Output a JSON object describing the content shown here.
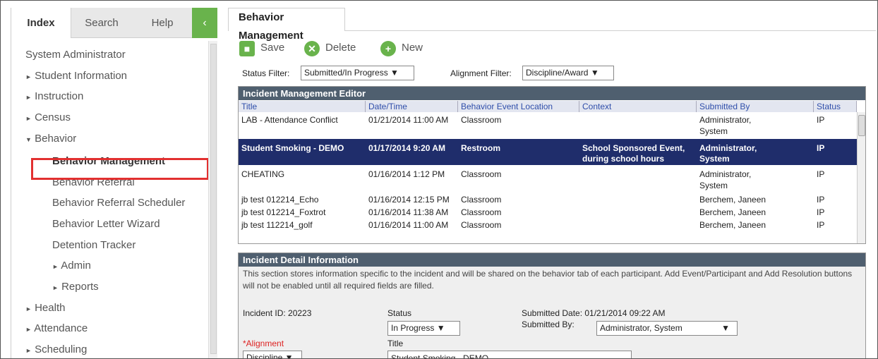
{
  "left_panel": {
    "tabs": [
      "Index",
      "Search",
      "Help"
    ],
    "collapse_symbol": "‹",
    "tree": [
      {
        "label": "System Administrator"
      },
      {
        "label": "Student Information",
        "arrow": "►"
      },
      {
        "label": "Instruction",
        "arrow": "►"
      },
      {
        "label": "Census",
        "arrow": "►"
      },
      {
        "label": "Behavior",
        "arrow": "▼"
      },
      {
        "label": "Behavior Management"
      },
      {
        "label": "Behavior Referral"
      },
      {
        "label": "Behavior Referral Scheduler"
      },
      {
        "label": "Behavior Letter Wizard"
      },
      {
        "label": "Detention Tracker"
      },
      {
        "label": "Admin",
        "arrow": "►"
      },
      {
        "label": "Reports",
        "arrow": "►"
      },
      {
        "label": "Health",
        "arrow": "►"
      },
      {
        "label": "Attendance",
        "arrow": "►"
      },
      {
        "label": "Scheduling",
        "arrow": "►"
      }
    ]
  },
  "main": {
    "tab_title": "Behavior Management",
    "toolbar": {
      "save_label": "Save",
      "delete_label": "Delete",
      "new_label": "New",
      "save_icon": "■",
      "delete_icon": "✕",
      "new_icon": "+"
    },
    "filters": {
      "status_label": "Status Filter:",
      "status_value": "Submitted/In Progress ▼",
      "alignment_label": "Alignment Filter:",
      "alignment_value": "Discipline/Award ▼"
    },
    "editor": {
      "title": "Incident Management Editor",
      "columns": [
        "Title",
        "Date/Time",
        "Behavior Event Location",
        "Context",
        "Submitted By",
        "Status"
      ],
      "rows": [
        {
          "title": "LAB - Attendance Conflict",
          "date": "01/21/2014 11:00 AM",
          "location": "Classroom",
          "context": "",
          "submitted_by_1": "Administrator,",
          "submitted_by_2": "System",
          "status": "IP"
        },
        {
          "title": "Student Smoking - DEMO",
          "date": "01/17/2014 9:20 AM",
          "location": "Restroom",
          "context_1": "School Sponsored Event,",
          "context_2": "during school hours",
          "submitted_by_1": "Administrator,",
          "submitted_by_2": "System",
          "status": "IP"
        },
        {
          "title": "CHEATING",
          "date": "01/16/2014 1:12 PM",
          "location": "Classroom",
          "context": "",
          "submitted_by_1": "Administrator,",
          "submitted_by_2": "System",
          "status": "IP"
        },
        {
          "title": "jb test 012214_Echo",
          "date": "01/16/2014 12:15 PM",
          "location": "Classroom",
          "submitted_by": "Berchem, Janeen",
          "status": "IP"
        },
        {
          "title": "jb test 012214_Foxtrot",
          "date": "01/16/2014 11:38 AM",
          "location": "Classroom",
          "submitted_by": "Berchem, Janeen",
          "status": "IP"
        },
        {
          "title": "jb test 112214_golf",
          "date": "01/16/2014 11:00 AM",
          "location": "Classroom",
          "submitted_by": "Berchem, Janeen",
          "status": "IP"
        }
      ]
    },
    "detail": {
      "title": "Incident Detail Information",
      "description": "This section stores information specific to the incident and will be shared on the behavior tab of each participant. Add Event/Participant and Add Resolution buttons will not be enabled until all required fields are filled.",
      "incident_id": "Incident ID: 20223",
      "status_label": "Status",
      "status_value": "In Progress ▼",
      "submitted_date": "Submitted Date: 01/21/2014 09:22 AM",
      "submitted_by_label": "Submitted By:",
      "submitted_by_value": "Administrator, System",
      "submitted_by_arrow": "▼",
      "alignment_label": "*Alignment",
      "alignment_value": "Discipline ▼",
      "title_label": "Title",
      "title_value": "Student Smoking - DEMO"
    }
  }
}
